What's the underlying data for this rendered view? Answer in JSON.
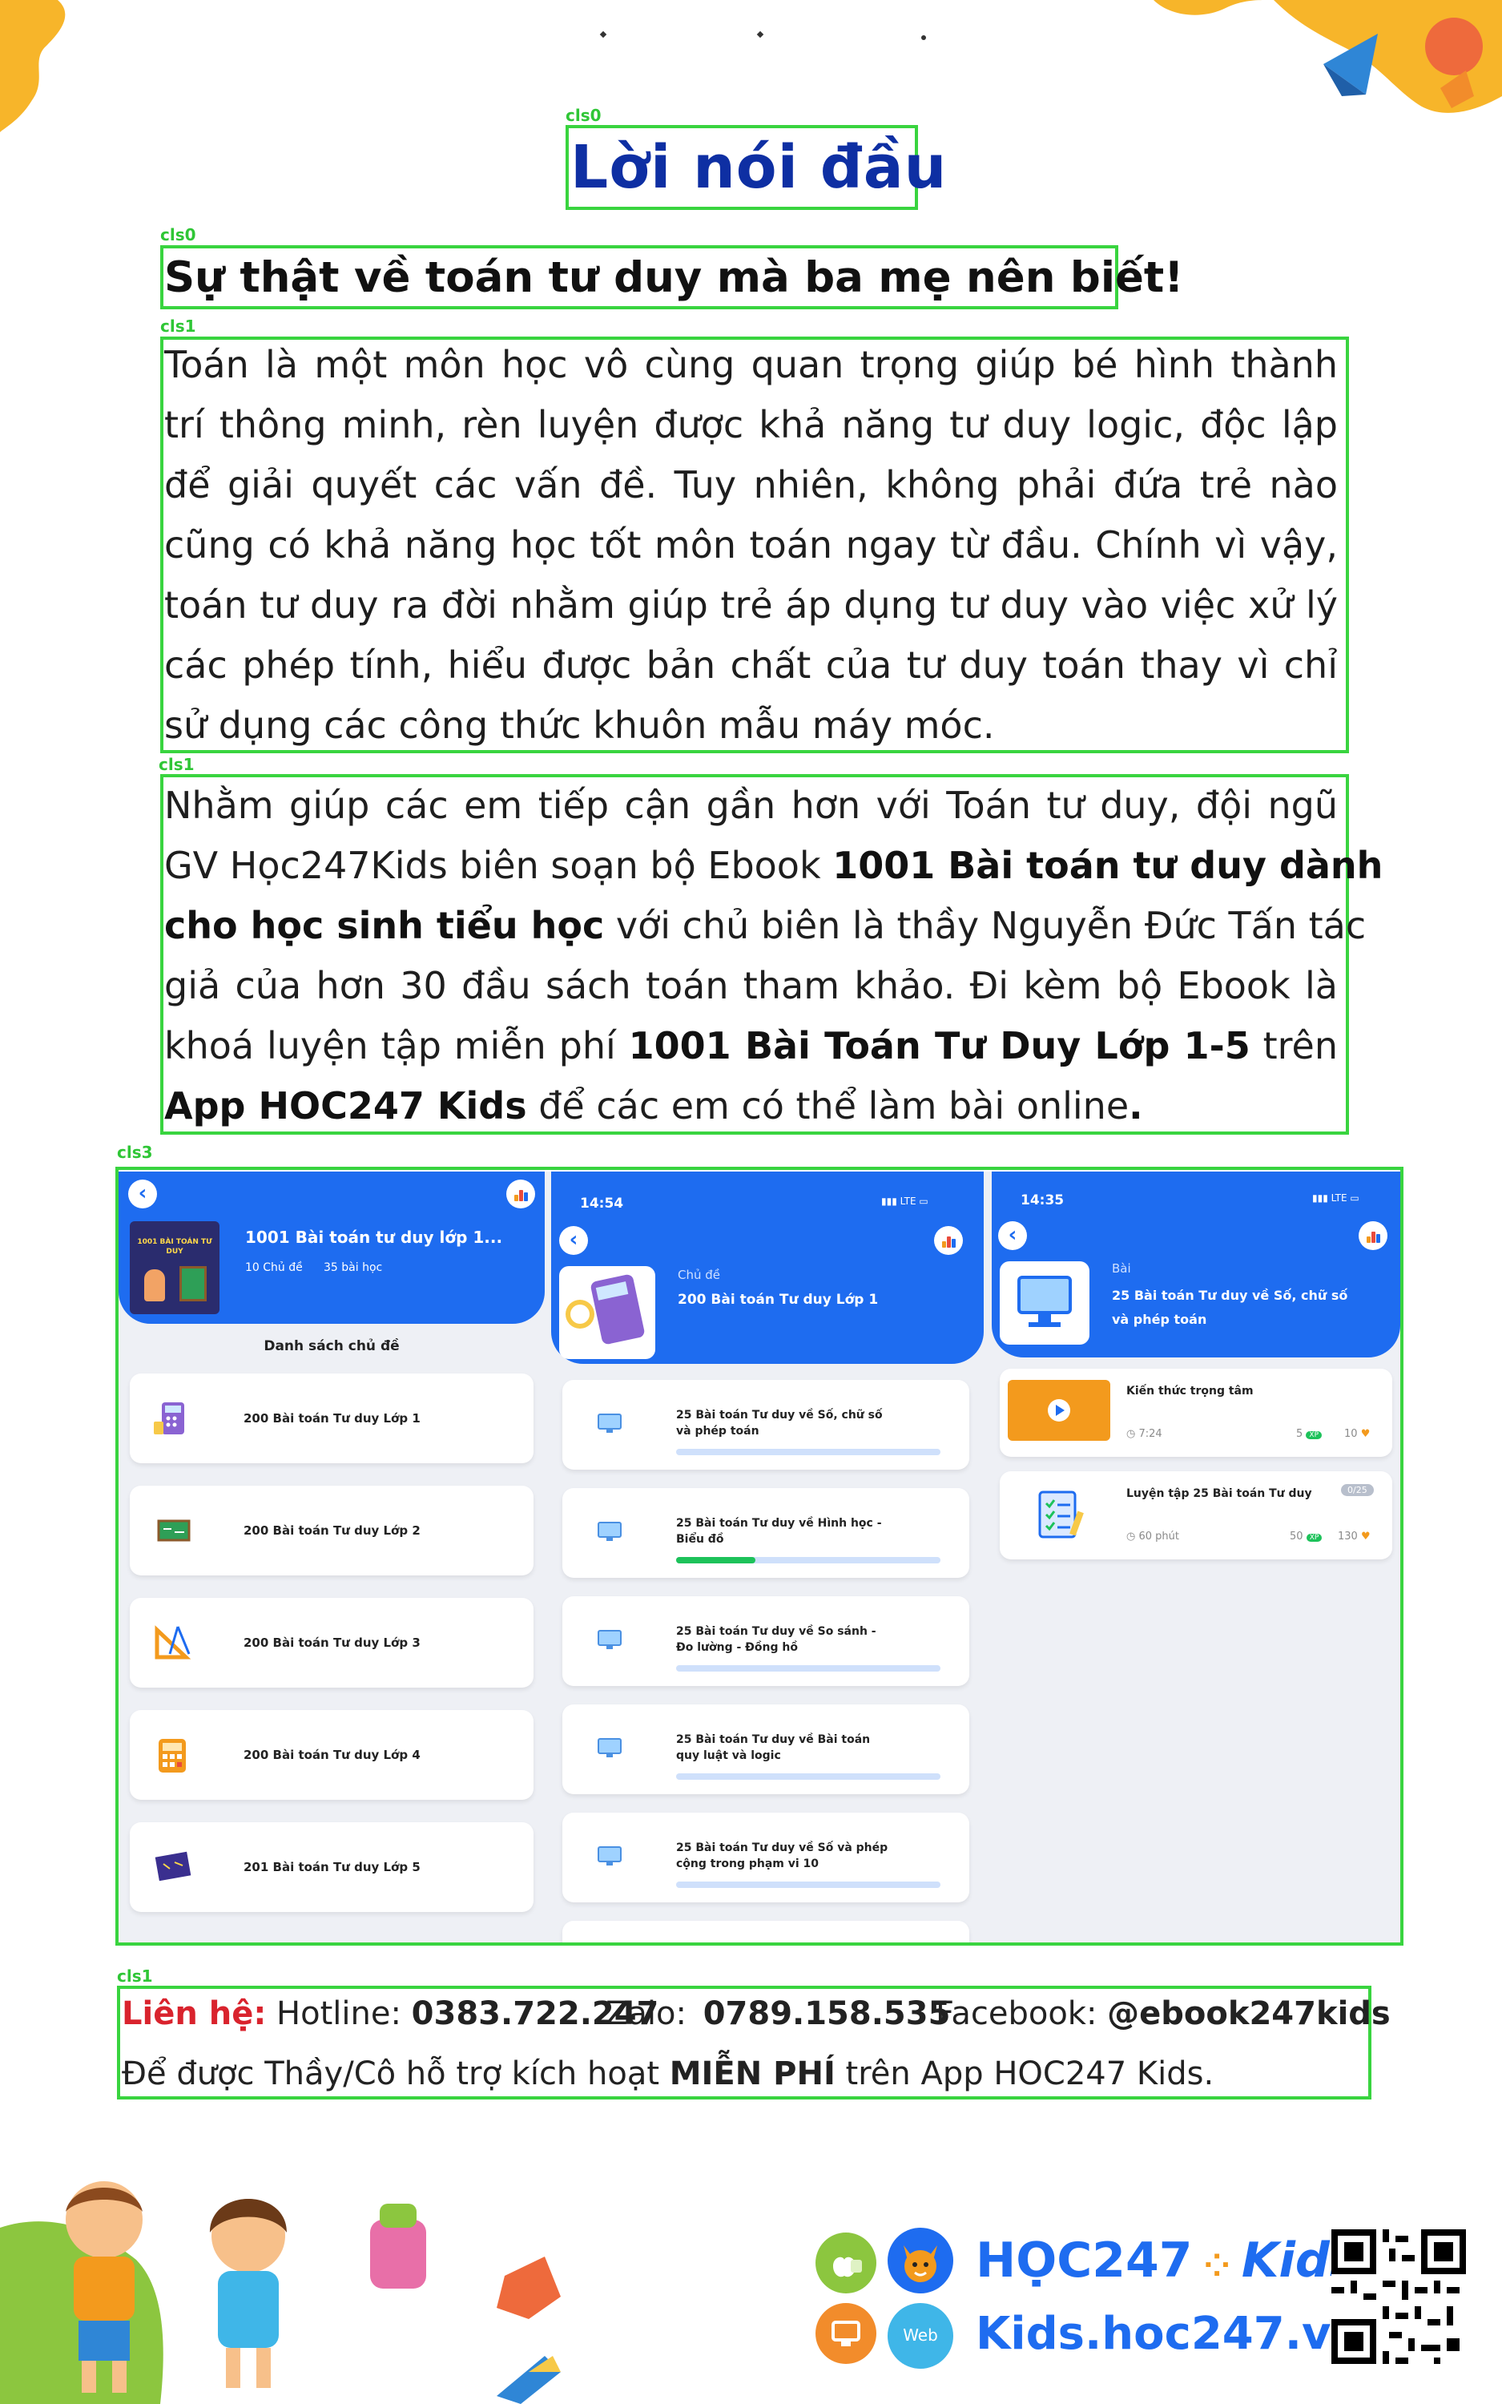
{
  "header": {
    "title": "Lời nói đầu",
    "subtitle": "Sự thật về toán tư duy mà ba mẹ nên biết!"
  },
  "detection_tags": {
    "title": "cls0",
    "subtitle": "cls0",
    "para1": "cls1",
    "para2": "cls1",
    "screens": "cls3",
    "contact": "cls1"
  },
  "para1": {
    "lines": [
      "Toán là một môn học vô cùng quan trọng giúp  bé hình thành",
      "trí thông minh, rèn luyện được khả năng tư duy logic, độc lập",
      "để giải quyết các vấn đề. Tuy nhiên, không phải đứa trẻ nào",
      "cũng có khả năng học tốt môn toán ngay từ đầu. Chính vì vậy,",
      "toán tư duy ra đời nhằm giúp trẻ áp dụng tư duy vào việc xử lý",
      "các phép tính, hiểu được bản chất của tư duy toán thay vì chỉ",
      "sử dụng các công thức khuôn mẫu máy móc."
    ]
  },
  "para2": {
    "l1": "Nhằm giúp các em tiếp cận gần hơn với Toán tư duy, đội ngũ",
    "l2a": "GV Học247Kids biên soạn bộ Ebook ",
    "l2b": "1001 Bài toán tư duy dành",
    "l3a": "cho học sinh tiểu học",
    "l3b": " với chủ biên là thầy Nguyễn Đức Tấn tác",
    "l4": "giả của hơn 30 đầu sách toán tham khảo. Đi kèm bộ Ebook là",
    "l5a": "khoá luyện tập miễn phí ",
    "l5b": "1001 Bài Toán Tư Duy Lớp 1-5",
    "l5c": " trên",
    "l6a": "App HOC247 Kids",
    "l6b": " để các em có thể làm bài online",
    "l6c": "."
  },
  "screen1": {
    "course_title": "1001 Bài toán tư duy lớp 1...",
    "course_meta_topics": "10 Chủ đề",
    "course_meta_lessons": "35 bài học",
    "cover_text": "1001 BÀI TOÁN TƯ DUY",
    "section_title": "Danh sách chủ đề",
    "items": [
      "200 Bài toán Tư duy Lớp 1",
      "200 Bài toán Tư duy Lớp 2",
      "200 Bài toán Tư duy Lớp 3",
      "200 Bài toán Tư duy Lớp 4",
      "201 Bài toán Tư duy Lớp 5"
    ]
  },
  "screen2": {
    "time": "14:54",
    "signal": "LTE",
    "kicker": "Chủ đề",
    "title": "200 Bài toán Tư duy Lớp 1",
    "items": [
      {
        "label1": "25 Bài toán Tư duy về Số, chữ số",
        "label2": "và phép toán",
        "progress": 0
      },
      {
        "label1": "25 Bài toán Tư duy về Hình học -",
        "label2": "Biểu đồ",
        "progress": 0.3
      },
      {
        "label1": "25 Bài toán Tư duy về So sánh -",
        "label2": "Đo lường - Đồng hồ",
        "progress": 0
      },
      {
        "label1": "25 Bài toán Tư duy về Bài toán",
        "label2": "quy luật và logic",
        "progress": 0
      },
      {
        "label1": "25 Bài toán Tư duy về Số và phép",
        "label2": "cộng trong phạm  vi 10",
        "progress": 0
      }
    ]
  },
  "screen3": {
    "time": "14:35",
    "signal": "LTE",
    "kicker": "Bài",
    "title1": "25 Bài toán Tư duy về Số, chữ số",
    "title2": "và phép toán",
    "card1": {
      "title": "Kiến thức trọng tâm",
      "duration": "7:24",
      "xp": "5",
      "xp_tag": "XP",
      "coins": "10"
    },
    "card2": {
      "title": "Luyện tập 25 Bài toán Tư duy",
      "badge": "0/25",
      "duration": "60 phút",
      "xp": "50",
      "xp_tag": "XP",
      "coins": "130"
    }
  },
  "contact": {
    "label": "Liên hệ:",
    "hotline_label": " Hotline: ",
    "hotline": "0383.722.247",
    "zalo_label": "Zalo: ",
    "zalo": "0789.158.535",
    "facebook_label": "Facebook: ",
    "facebook": "@ebook247kids",
    "line2a": "Để được Thầy/Cô hỗ trợ kích hoạt ",
    "line2b": "MIỄN PHÍ",
    "line2c": " trên App HOC247 Kids."
  },
  "footer": {
    "brand_hoc": "HỌC247",
    "brand_kids": "Kids",
    "website": "Kids.hoc247.vn",
    "web_badge": "Web"
  },
  "colors": {
    "primary_blue": "#1e6cf0",
    "title_blue": "#0e2fa3",
    "detect_green": "#39d43f",
    "alert_red": "#d9232d"
  }
}
